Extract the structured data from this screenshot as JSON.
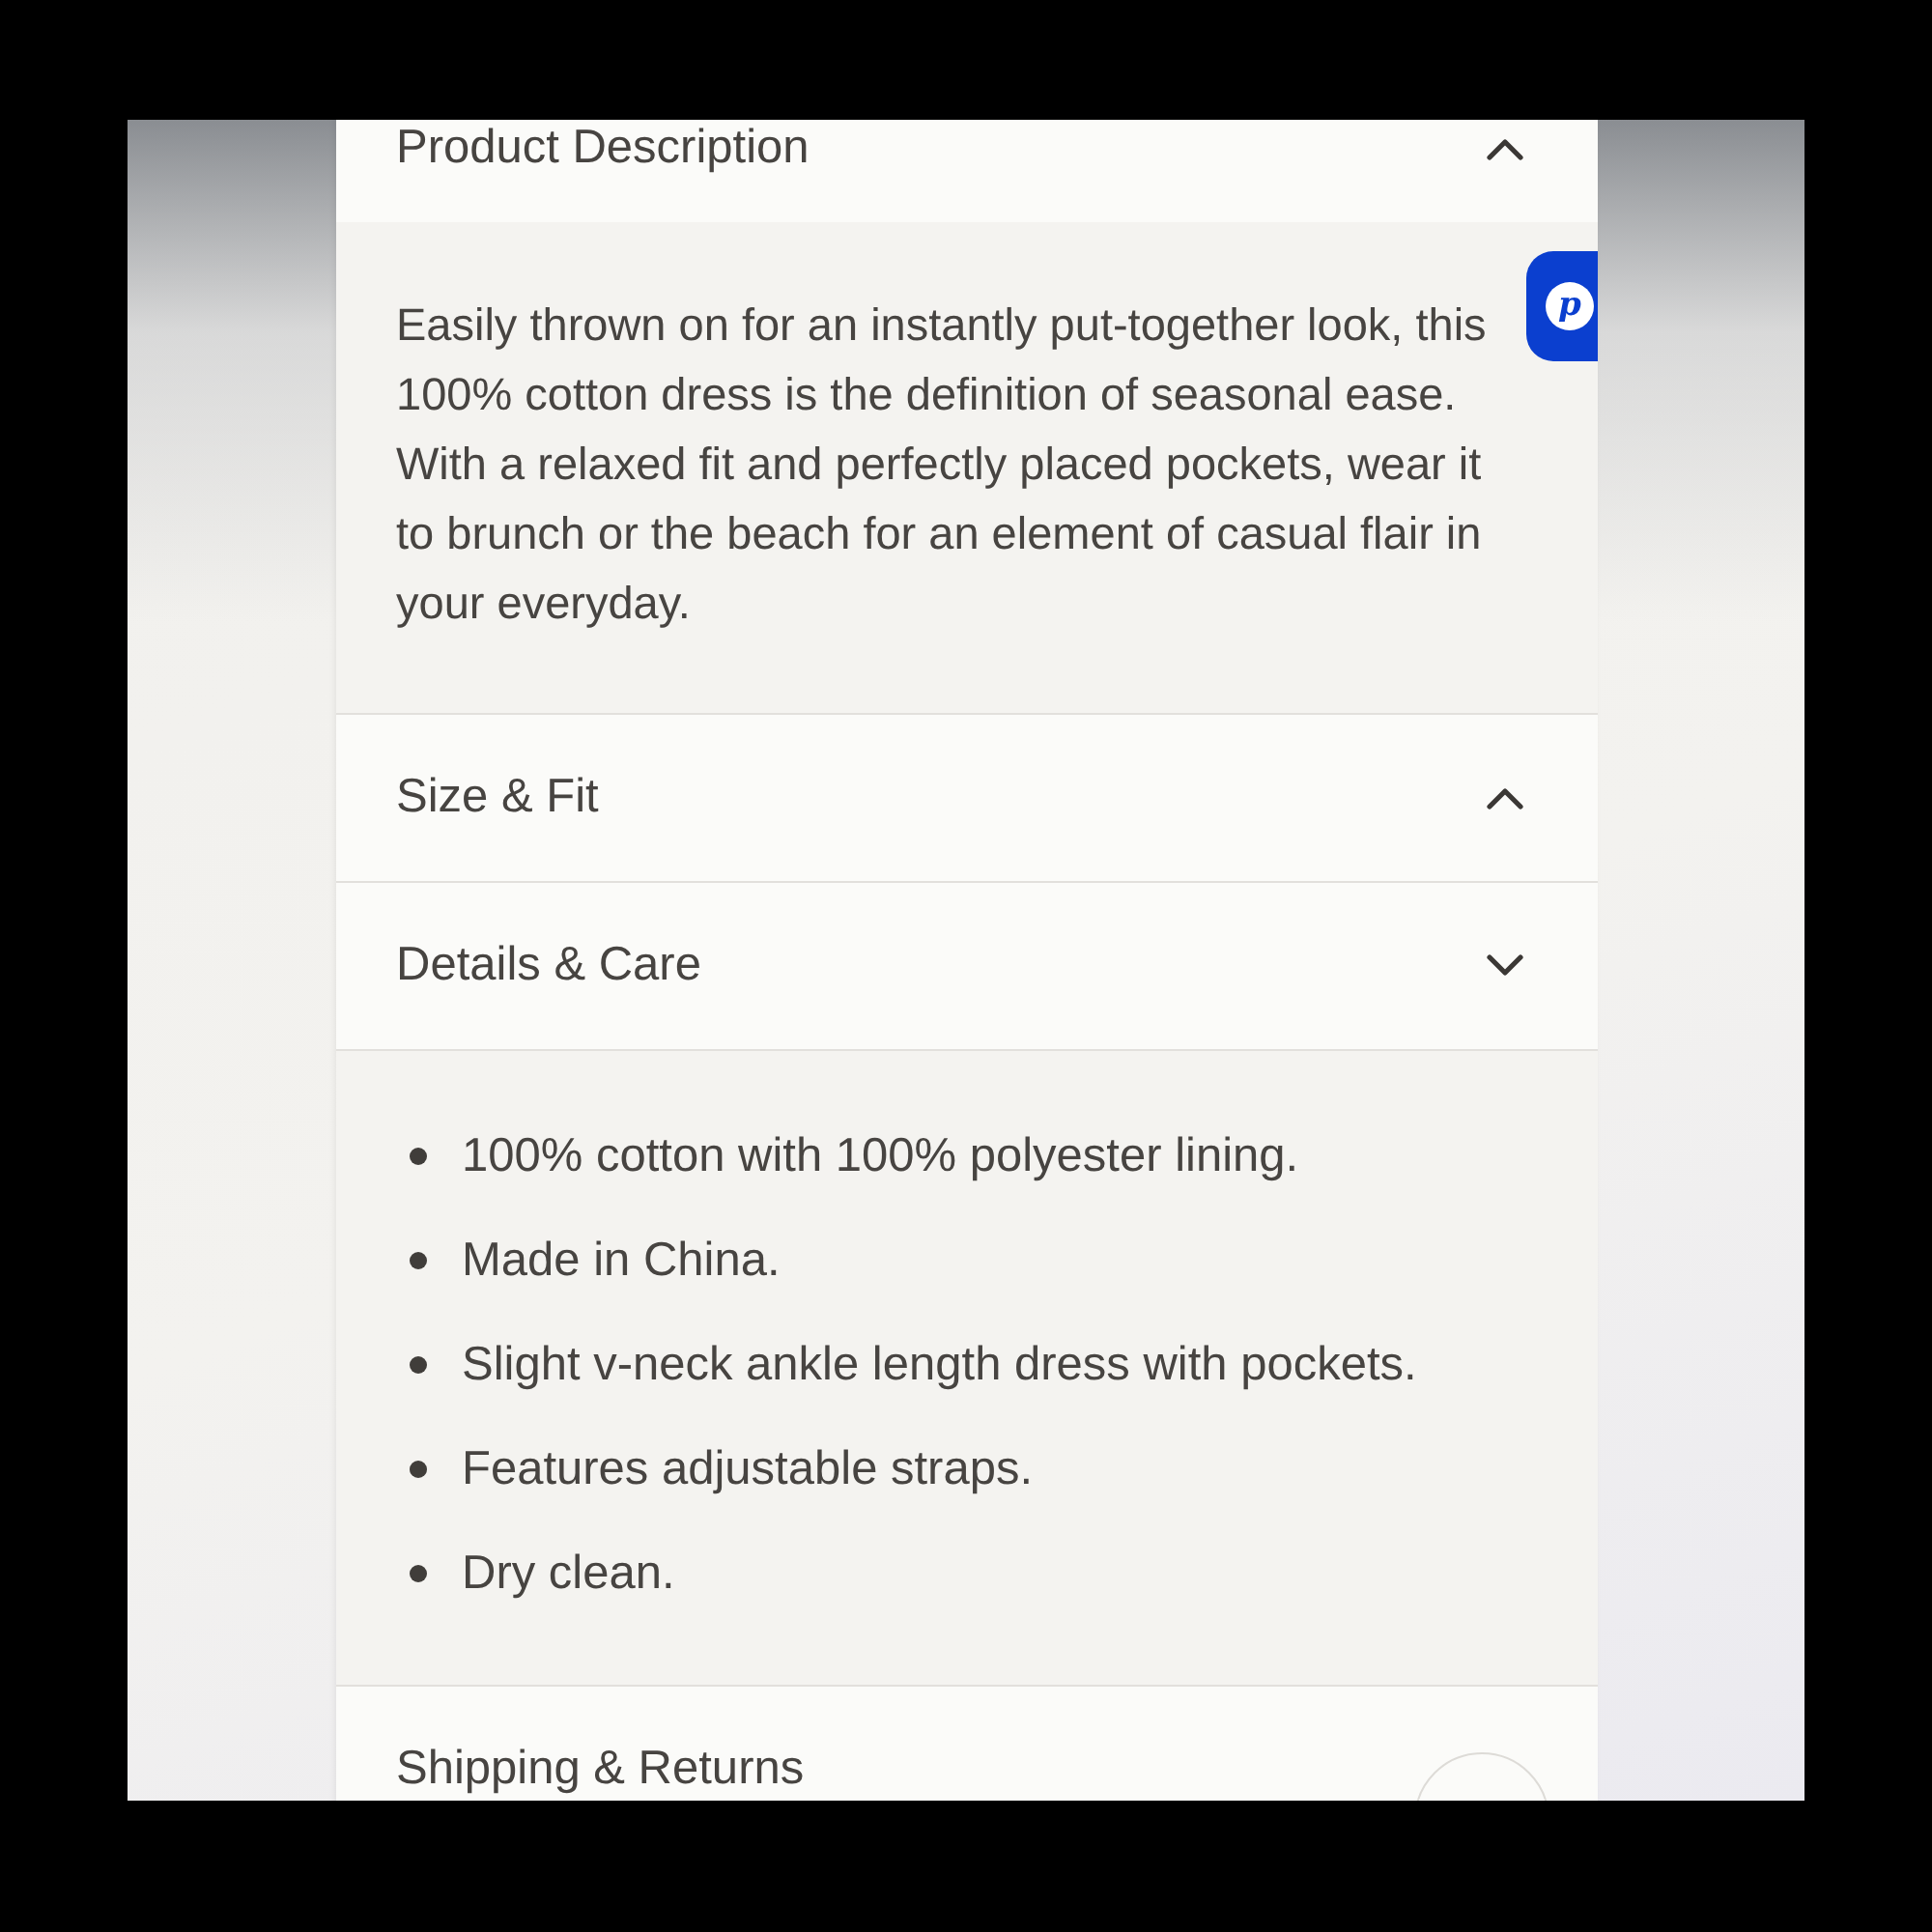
{
  "sections": [
    {
      "title": "Product Description",
      "expanded": true,
      "body": "Easily thrown on for an instantly put-together look, this 100% cotton dress is the definition of seasonal ease. With a relaxed fit and perfectly placed pockets, wear it to brunch or the beach for an element of casual flair in your everyday."
    },
    {
      "title": "Size & Fit",
      "expanded": true
    },
    {
      "title": "Details & Care",
      "expanded": false,
      "items": [
        "100% cotton with 100% polyester lining.",
        "Made in China.",
        "Slight v-neck ankle length dress with pockets.",
        "Features adjustable straps.",
        "Dry clean."
      ]
    },
    {
      "title": "Shipping & Returns"
    }
  ],
  "badge": {
    "letter": "p"
  }
}
